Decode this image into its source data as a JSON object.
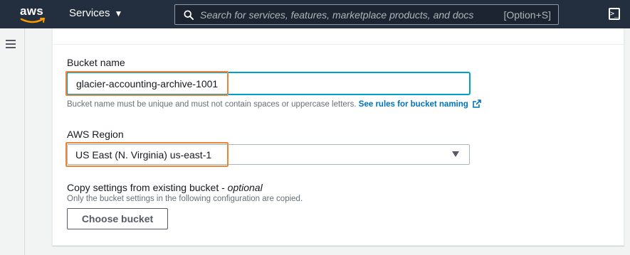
{
  "topnav": {
    "logo_text": "aws",
    "services_label": "Services",
    "search_placeholder": "Search for services, features, marketplace products, and docs",
    "search_shortcut": "[Option+S]"
  },
  "form": {
    "bucket_name": {
      "label": "Bucket name",
      "value": "glacier-accounting-archive-1001",
      "hint": "Bucket name must be unique and must not contain spaces or uppercase letters.",
      "rules_link": "See rules for bucket naming"
    },
    "region": {
      "label": "AWS Region",
      "selected": "US East (N. Virginia) us-east-1"
    },
    "copy_settings": {
      "label": "Copy settings from existing bucket - ",
      "label_optional": "optional",
      "hint": "Only the bucket settings in the following configuration are copied.",
      "button": "Choose bucket"
    }
  },
  "colors": {
    "nav_bg": "#232f3e",
    "focus": "#00a1c9",
    "highlight": "#e8873a",
    "link": "#0073bb"
  }
}
